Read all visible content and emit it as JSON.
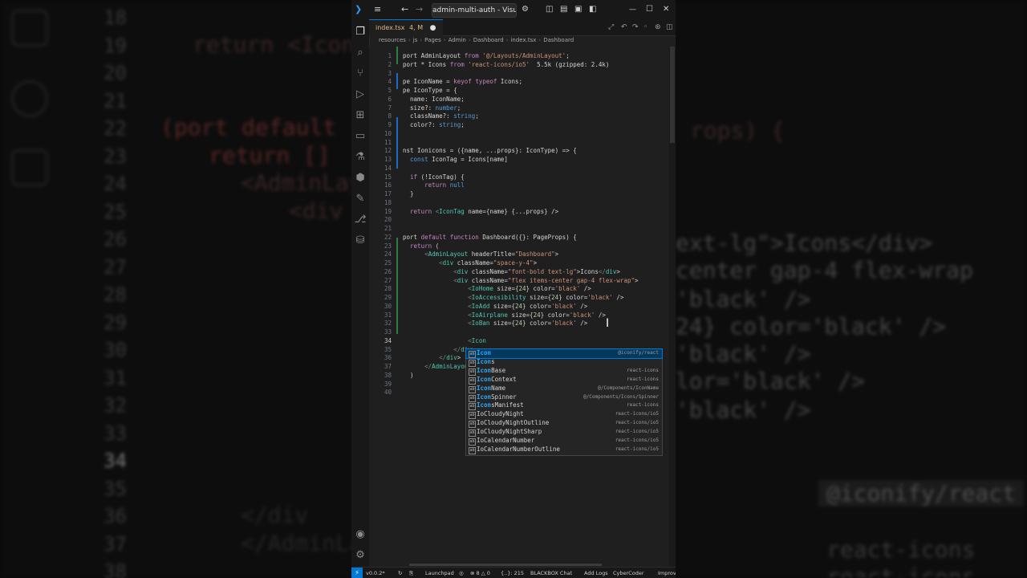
{
  "titlebar": {
    "back": "←",
    "forward": "→",
    "title": "admin-multi-auth - Visual",
    "menu": "≡",
    "minimize": "—",
    "maximize": "☐",
    "close": "✕"
  },
  "tab": {
    "name": "index.tsx",
    "status": "4, M",
    "dirty": "●"
  },
  "breadcrumb": [
    "resources",
    "js",
    "Pages",
    "Admin",
    "Dashboard",
    "index.tsx",
    "Dashboard"
  ],
  "activity_icons": [
    "files-icon",
    "search-icon",
    "source-control-icon",
    "run-debug-icon",
    "extensions-icon",
    "remote-icon",
    "testing-icon",
    "docker-icon",
    "blackbox-icon",
    "git-graph-icon",
    "database-icon"
  ],
  "editor": {
    "line_numbers": [
      "1",
      "2",
      "3",
      "4",
      "5",
      "6",
      "7",
      "8",
      "9",
      "10",
      "11",
      "12",
      "13",
      "14",
      "15",
      "16",
      "17",
      "18",
      "19",
      "20",
      "21",
      "22",
      "23",
      "24",
      "25",
      "26",
      "27",
      "28",
      "29",
      "30",
      "31",
      "32",
      "33",
      "34",
      "35",
      "36",
      "37",
      "38",
      "39",
      "40"
    ],
    "current_line": "34",
    "lines": [
      "port AdminLayout from '@/Layouts/AdminLayout';",
      "port * Icons from 'react-icons/io5'  5.5k (gzipped: 2.4k)",
      "",
      "pe IconName = keyof typeof Icons;",
      "pe IconType = {",
      "  name: IconName;",
      "  size?: number;",
      "  className?: string;",
      "  color?: string;",
      "",
      "",
      "nst Ionicons = ({name, ...props}: IconType) => {",
      "  const IconTag = Icons[name]",
      "",
      "  if (!IconTag) {",
      "      return null",
      "  }",
      "",
      "  return <IconTag name={name} {...props} />",
      "",
      "",
      "port default function Dashboard({}: PageProps) {",
      "  return (",
      "      <AdminLayout headerTitle=\"Dashboard\">",
      "          <div className=\"space-y-4\">",
      "              <div className=\"font-bold text-lg\">Icons</div>",
      "              <div className=\"flex items-center gap-4 flex-wrap\">",
      "                  <IoHome size={24} color='black' />",
      "                  <IoAccessibility size={24} color='black' />",
      "                  <IoAdd size={24} color='black' />",
      "                  <IoAirplane size={24} color='black' />",
      "                  <IoBan size={24} color='black' />",
      "",
      "                  <Icon",
      "              </div>",
      "          </div>",
      "      </AdminLayout>",
      "  )",
      "",
      ""
    ]
  },
  "suggest": {
    "typed": "Icon",
    "items": [
      {
        "label": "Icon",
        "source": "@iconify/react"
      },
      {
        "label": "Icons",
        "source": ""
      },
      {
        "label": "IconBase",
        "source": "react-icons"
      },
      {
        "label": "IconContext",
        "source": "react-icons"
      },
      {
        "label": "IconName",
        "source": "@/Components/IconName"
      },
      {
        "label": "IconSpinner",
        "source": "@/Components/Icons/Spinner"
      },
      {
        "label": "IconsManifest",
        "source": "react-icons"
      },
      {
        "label": "IoCloudyNight",
        "source": "react-icons/io5"
      },
      {
        "label": "IoCloudyNightOutline",
        "source": "react-icons/io5"
      },
      {
        "label": "IoCloudyNightSharp",
        "source": "react-icons/io5"
      },
      {
        "label": "IoCalendarNumber",
        "source": "react-icons/io5"
      },
      {
        "label": "IoCalendarNumberOutline",
        "source": "react-icons/io5"
      }
    ]
  },
  "statusbar": {
    "version": "v0.0.2*",
    "launchpad": "Launchpad",
    "problems": "⊗ 8 △ 0",
    "position": "{..}: 215",
    "blackbox": "BLACKBOX Chat",
    "addlogs": "Add Logs",
    "cybercoder": "CyberCoder",
    "improve": "Improve"
  },
  "background": {
    "line_numbers": [
      "18",
      "19",
      "20",
      "21",
      "22",
      "23",
      "24",
      "25",
      "26",
      "27",
      "28",
      "29",
      "30",
      "31",
      "32",
      "33",
      "34",
      "35",
      "36",
      "37",
      "38"
    ],
    "left_lines": [
      "",
      "return <IconT",
      "",
      "",
      "(port default fu",
      "return []",
      "<AdminLay",
      "<div",
      "",
      "",
      "",
      "",
      "",
      "",
      "",
      "",
      "",
      "",
      "</div",
      "</AdminLa",
      ""
    ],
    "right_lines": [
      "ext-lg\">Icons</div>",
      "center gap-4 flex-wrap",
      "'black' />",
      "24} color='black' />",
      "'black' />",
      "lor='black' />",
      "'black' />",
      "@iconify/react",
      "react-icons",
      "react-icons"
    ],
    "right_top": "rops) {"
  },
  "colors": {
    "accent": "#0078d4",
    "editor_bg": "#1f1f1f",
    "suggest_match": "#2aaaff"
  }
}
